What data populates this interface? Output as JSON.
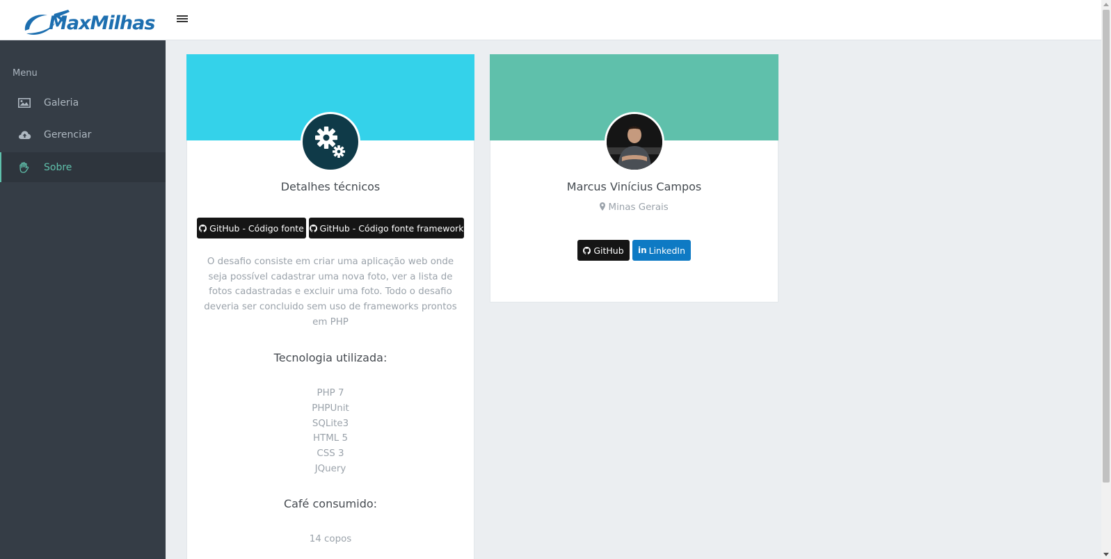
{
  "header": {
    "logo_text": "MaxMilhas",
    "menu_toggle_icon": "hamburger-icon"
  },
  "sidebar": {
    "menu_title": "Menu",
    "items": [
      {
        "label": "Galeria",
        "icon": "image-icon",
        "active": false
      },
      {
        "label": "Gerenciar",
        "icon": "cloud-upload-icon",
        "active": false
      },
      {
        "label": "Sobre",
        "icon": "hand-icon",
        "active": true
      }
    ]
  },
  "colors": {
    "accent": "#5fc0ab",
    "tech_banner": "#34d2ea",
    "profile_banner": "#5fc0ab",
    "sidebar_bg": "#353d46"
  },
  "tech_card": {
    "avatar_icon": "gears-icon",
    "title": "Detalhes técnicos",
    "btn_source": "GitHub - Código fonte",
    "btn_framework": "GitHub - Código fonte framework",
    "description": "O desafio consiste em criar uma aplicação web onde seja possível cadastrar uma nova foto, ver a lista de fotos cadastradas e excluir uma foto. Todo o desafio deveria ser concluido sem uso de frameworks prontos em PHP",
    "tech_heading": "Tecnologia utilizada:",
    "technologies": [
      "PHP 7",
      "PHPUnit",
      "SQLite3",
      "HTML 5",
      "CSS 3",
      "JQuery"
    ],
    "coffee_heading": "Café consumido:",
    "coffee_value": "14 copos"
  },
  "profile_card": {
    "name": "Marcus Vinícius Campos",
    "location": "Minas Gerais",
    "btn_github": "GitHub",
    "btn_linkedin": "LinkedIn"
  }
}
